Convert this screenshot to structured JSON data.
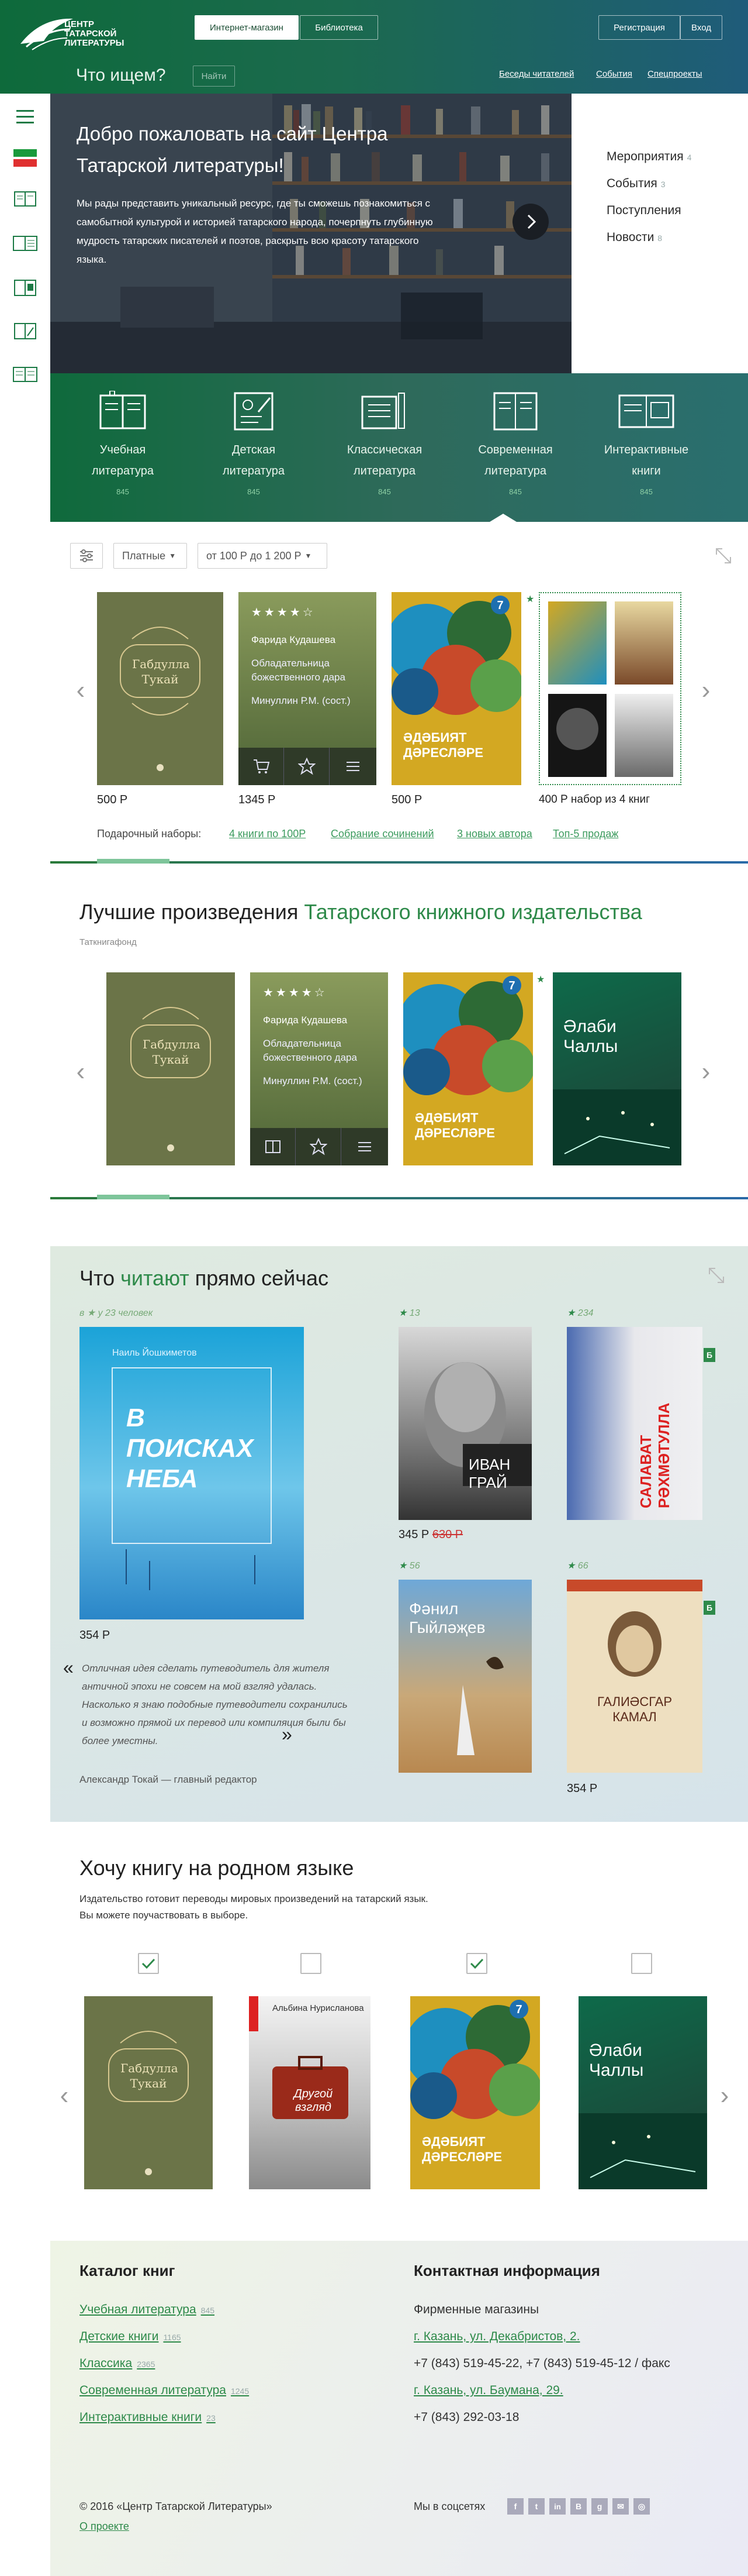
{
  "header": {
    "logo_line1": "ЦЕНТР",
    "logo_line2": "ТАТАРСКОЙ",
    "logo_line3": "ЛИТЕРАТУРЫ",
    "tab_shop": "Интернет-магазин",
    "tab_library": "Библиотека",
    "register": "Регистрация",
    "login": "Вход",
    "search_title": "Что ищем?",
    "find": "Найти",
    "link1": "Беседы читателей",
    "link2": "События",
    "link3": "Спецпроекты"
  },
  "sidebar": {
    "icons": [
      "search-icon",
      "menu-icon",
      "flag-icon",
      "book-open-icon",
      "book-list-icon",
      "book-icon",
      "book-edit-icon",
      "book-text-icon"
    ]
  },
  "hero": {
    "title": "Добро пожаловать на сайт Центра Татарской литературы!",
    "text": "Мы рады представить уникальный ресурс, где ты сможешь познакомиться с самобытной культурой и историей татарского народа, почерпнуть глубинную мудрость татарских писателей и поэтов, раскрыть всю красоту татарского языка."
  },
  "rpanel": {
    "items": [
      {
        "label": "Мероприятия",
        "count": "4"
      },
      {
        "label": "События",
        "count": "3"
      },
      {
        "label": "Поступления",
        "count": ""
      },
      {
        "label": "Новости",
        "count": "8"
      }
    ]
  },
  "categories": [
    {
      "line1": "Учебная",
      "line2": "литература",
      "count": "845"
    },
    {
      "line1": "Детская",
      "line2": "литература",
      "count": "845"
    },
    {
      "line1": "Классическая",
      "line2": "литература",
      "count": "845"
    },
    {
      "line1": "Современная",
      "line2": "литература",
      "count": "845"
    },
    {
      "line1": "Интерактивные",
      "line2": "книги",
      "count": "845"
    }
  ],
  "filters": {
    "paid": "Платные",
    "range": "от 100 Р до 1 200 Р"
  },
  "carousel1": {
    "prices": [
      "500 Р",
      "1345 Р",
      "500 Р",
      "400 Р набор из 4 книг"
    ],
    "book1_title": "Габдулла Тукай",
    "hover_author": "Фарида Кудашева",
    "hover_title": "Обладательница божественного дара",
    "hover_editor": "Минуллин Р.М. (сост.)",
    "book3_title": "ӘДӘБИЯТ ДӘРЕСЛӘРЕ",
    "set_label": "Подарочный наборы:",
    "sets": [
      "4 книги по 100Р",
      "Собрание сочинений",
      "3 новых автора",
      "Топ-5 продаж"
    ]
  },
  "best": {
    "title_a": "Лучшие произведения ",
    "title_b": "Татарского книжного издательства",
    "subtitle": "Таткнигафонд",
    "book4_title": "Әлаби Чаллы"
  },
  "reading": {
    "title_a": "Что ",
    "title_b": "читают",
    "title_c": " прямо сейчас",
    "count_note": "в ★ у 23 человек",
    "main_price": "354 Р",
    "main_author": "Наиль Йошкиметов",
    "main_title": "В ПОИСКАХ НЕБА",
    "quote": "Отличная идея сделать путеводитель для жителя античной эпохи не совсем на мой взгляд удалась. Насколько я знаю подобные путеводители сохранились и возможно прямой их перевод или компиляция были бы более уместны.",
    "quote_author": "Александр Токай",
    "quote_role": "главный редактор",
    "side_books": [
      {
        "stars": "13",
        "title": "ИВАН ГРАЙ",
        "price": "345 Р",
        "old": "630 Р"
      },
      {
        "stars": "234",
        "title": "САЛАВАТ РӘХМӘТУЛЛА",
        "price": "",
        "old": "",
        "badge": "Б"
      },
      {
        "stars": "56",
        "title": "Фәнил Гыйләҗев",
        "price": "",
        "old": ""
      },
      {
        "stars": "66",
        "title": "ГАЛИӘСГАР КАМАЛ",
        "price": "354 Р",
        "old": "",
        "badge": "Б"
      }
    ]
  },
  "native": {
    "title": "Хочу книгу на родном языке",
    "text1": "Издательство готовит переводы мировых произведений на татарский язык.",
    "text2": "Вы можете поучаствовать в выборе.",
    "checks": [
      true,
      false,
      true,
      false
    ],
    "book2_author": "Альбина Нурисланова",
    "book2_title": "Другой взгляд"
  },
  "footer": {
    "catalog_title": "Каталог книг",
    "catalog": [
      {
        "label": "Учебная литература",
        "count": "845"
      },
      {
        "label": "Детские книги",
        "count": "1165"
      },
      {
        "label": "Классика",
        "count": "2365"
      },
      {
        "label": "Современная литература",
        "count": "1245"
      },
      {
        "label": "Интерактивные книги",
        "count": "23"
      }
    ],
    "contact_title": "Контактная информация",
    "shops": "Фирменные магазины",
    "addr1": "г. Казань, ул. Декабристов, 2.",
    "phone1": "+7 (843) 519-45-22, +7 (843) 519-45-12 / факс",
    "addr2": "г. Казань, ул. Баумана, 29.",
    "phone2": "+7 (843) 292-03-18",
    "copyright": "© 2016 «Центр Татарской Литературы»",
    "about": "О проекте",
    "social_label": "Мы в соцсетях",
    "social": [
      "f",
      "t",
      "in",
      "B",
      "g",
      "✉",
      "◎"
    ]
  },
  "colors": {
    "green": "#2e8a4a",
    "blue": "#2a6aa8",
    "dark": "#0e6a3b"
  }
}
